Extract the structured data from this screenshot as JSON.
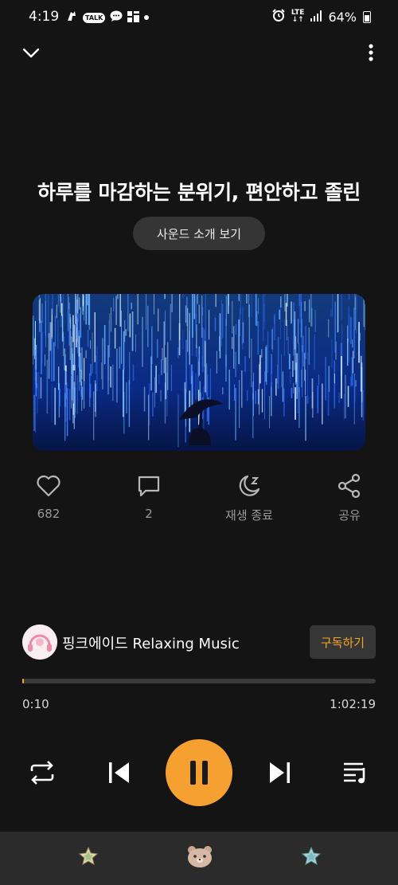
{
  "status_bar": {
    "time": "4:19",
    "talk_badge": "TALK",
    "network": "LTE",
    "battery": "64%"
  },
  "track": {
    "title": "하루를 마감하는 분위기, 편안하고 졸린",
    "intro_button": "사운드 소개 보기"
  },
  "actions": {
    "like_count": "682",
    "comment_count": "2",
    "sleep_timer_label": "재생 종료",
    "share_label": "공유"
  },
  "channel": {
    "name": "핑크에이드 Relaxing Music",
    "subscribe_label": "구독하기"
  },
  "playback": {
    "current_time": "0:10",
    "total_time": "1:02:19",
    "progress_fraction": 0.003
  },
  "colors": {
    "accent": "#f7a032",
    "background": "#141414"
  }
}
